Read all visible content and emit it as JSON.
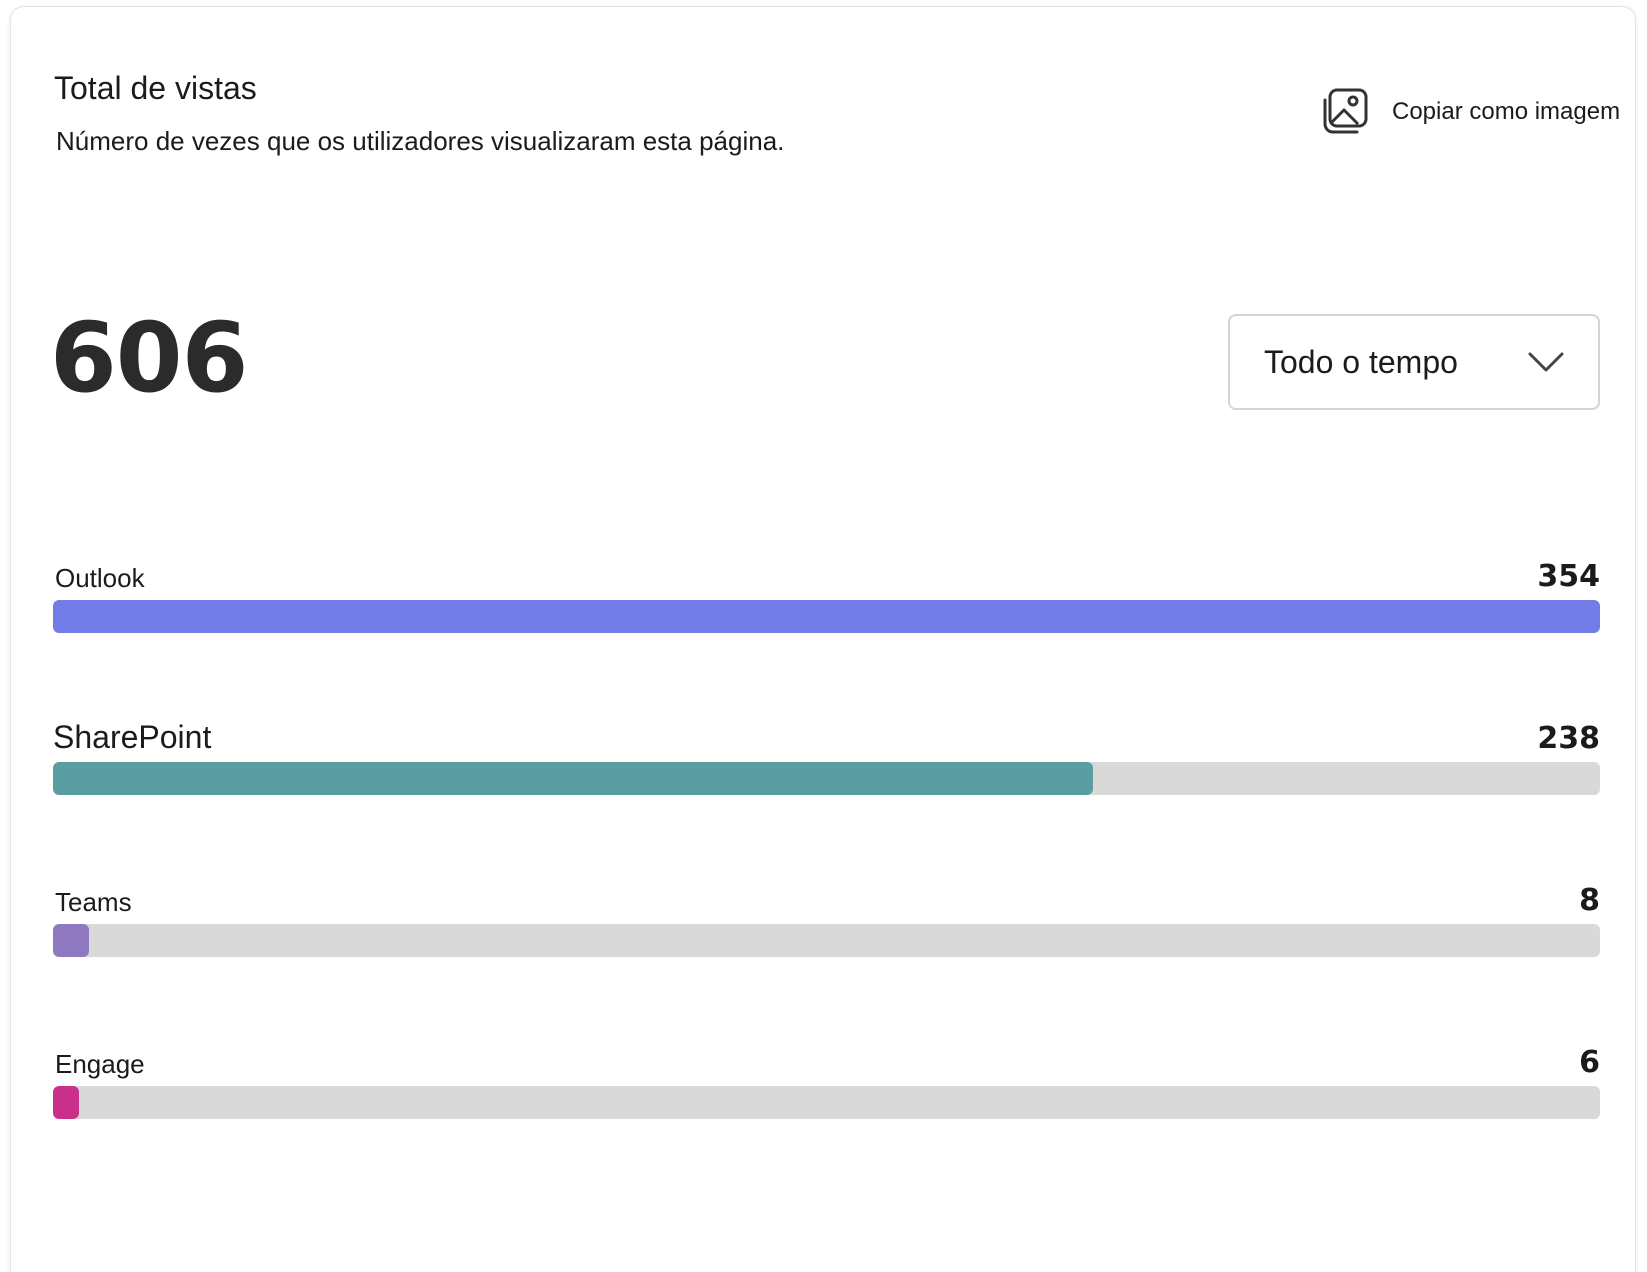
{
  "header": {
    "title": "Total de vistas",
    "subtitle": "Número de vezes que os utilizadores visualizaram esta página.",
    "copy_label": "Copiar como imagem",
    "copy_icon": "image-copy-icon"
  },
  "summary": {
    "total": "606"
  },
  "filter": {
    "selected": "Todo o tempo",
    "icon": "chevron-down-icon"
  },
  "sources": [
    {
      "name": "Outlook",
      "count": "354",
      "fraction": 1.0,
      "color": "#737be6"
    },
    {
      "name": "SharePoint",
      "count": "238",
      "fraction": 0.672,
      "color": "#5b9ea2"
    },
    {
      "name": "Teams",
      "count": "8",
      "fraction": 0.023,
      "color": "#8e78c0"
    },
    {
      "name": "Engage",
      "count": "6",
      "fraction": 0.017,
      "color": "#c8308c"
    }
  ],
  "colors": {
    "track": "#d9d9d9"
  }
}
